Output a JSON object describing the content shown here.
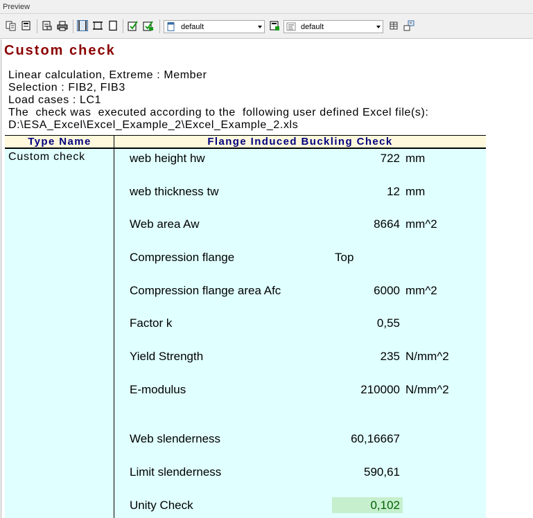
{
  "window": {
    "title": "Preview"
  },
  "toolbar": {
    "combo1_value": "default",
    "combo2_value": "default"
  },
  "report": {
    "heading": "Custom check",
    "info_lines": [
      "Linear calculation, Extreme : Member",
      "Selection : FIB2, FIB3",
      "Load cases : LC1",
      "The  check was  executed according to the  following user defined Excel file(s):",
      "D:\\ESA_Excel\\Excel_Example_2\\Excel_Example_2.xls"
    ],
    "table": {
      "col1_header": "Type Name",
      "col2_header": "Flange Induced Buckling Check",
      "type_name": "Custom check",
      "rows": [
        {
          "label": "web height hw",
          "value": "722",
          "unit": "mm"
        },
        {
          "label": "web thickness tw",
          "value": "12",
          "unit": "mm"
        },
        {
          "label": "Web area Aw",
          "value": "8664",
          "unit": "mm^2"
        },
        {
          "label": "Compression flange",
          "value": "Top",
          "unit": ""
        },
        {
          "label": "Compression flange area Afc",
          "value": "6000",
          "unit": "mm^2"
        },
        {
          "label": "Factor k",
          "value": "0,55",
          "unit": ""
        },
        {
          "label": "Yield Strength",
          "value": "235",
          "unit": "N/mm^2"
        },
        {
          "label": "E-modulus",
          "value": "210000",
          "unit": "N/mm^2"
        },
        {
          "label": "Web slenderness",
          "value": "60,16667",
          "unit": ""
        },
        {
          "label": "Limit slenderness",
          "value": "590,61",
          "unit": ""
        },
        {
          "label": "Unity Check",
          "value": "0,102",
          "unit": ""
        }
      ]
    }
  },
  "colors": {
    "heading": "#8b0000",
    "header_text": "#00007f",
    "header_bg": "#fff8dc",
    "table_bg": "#e0ffff",
    "unity_bg": "#c6efce",
    "unity_text": "#006100"
  }
}
